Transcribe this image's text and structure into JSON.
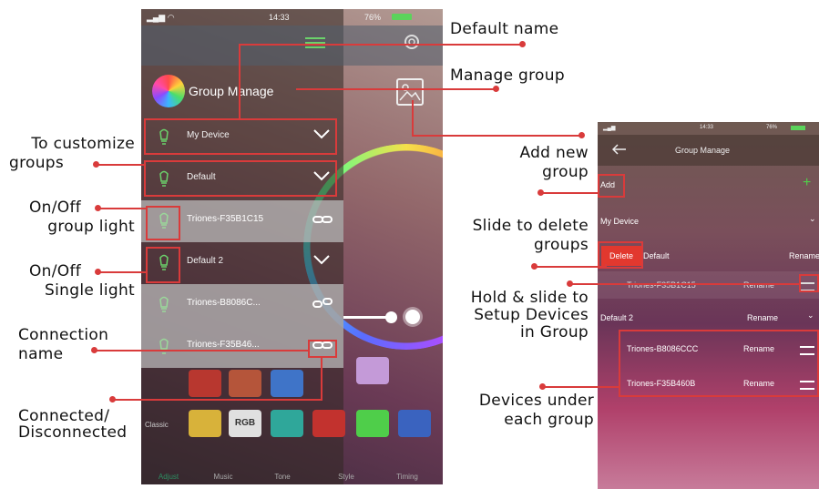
{
  "callouts": {
    "default_name": "Default name",
    "manage_group": "Manage group",
    "to_customize_l1": "To customize",
    "to_customize_l2": "groups",
    "onoff_group_l1": "On/Off",
    "onoff_group_l2": "group light",
    "onoff_single_l1": "On/Off",
    "onoff_single_l2": "Single light",
    "connection_l1": "Connection",
    "connection_l2": "name",
    "connected_l1": "Connected/",
    "connected_l2": "Disconnected",
    "add_new_l1": "Add new",
    "add_new_l2": "group",
    "slide_delete_l1": "Slide to delete",
    "slide_delete_l2": "groups",
    "hold_slide_l1": "Hold & slide to",
    "hold_slide_l2": "Setup Devices",
    "hold_slide_l3": "in Group",
    "devices_under_l1": "Devices under",
    "devices_under_l2": "each group"
  },
  "phone1": {
    "status_time": "14:33",
    "status_battery": "76%",
    "title": "Group Manage",
    "rows": [
      {
        "label": "My Device"
      },
      {
        "label": "Default"
      },
      {
        "label": "Triones-F35B1C15"
      },
      {
        "label": "Default 2"
      },
      {
        "label": "Triones-B8086C..."
      },
      {
        "label": "Triones-F35B46..."
      }
    ],
    "classic_label": "Classic",
    "rgb_label": "RGB",
    "tabs": [
      "Adjust",
      "Music",
      "Tone",
      "Style",
      "Timing"
    ]
  },
  "phone2": {
    "status_time": "14:33",
    "status_battery": "76%",
    "title": "Group Manage",
    "add": "Add",
    "my_device": "My Device",
    "delete": "Delete",
    "default": "Default",
    "rename": "Rename",
    "dev1": "Triones-F35B1C15",
    "default2": "Default 2",
    "dev2": "Triones-B8086CCC",
    "dev3": "Triones-F35B460B"
  },
  "colors": {
    "accent_red": "#d93b3b",
    "icon_green": "#6bd26b"
  }
}
